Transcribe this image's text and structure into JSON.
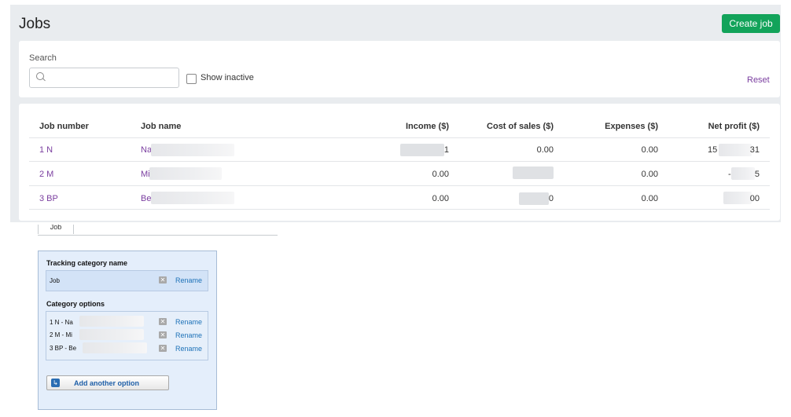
{
  "header": {
    "title": "Jobs",
    "create_label": "Create job"
  },
  "filters": {
    "search_label": "Search",
    "search_value": "",
    "show_inactive_label": "Show inactive",
    "show_inactive_checked": false,
    "reset_label": "Reset"
  },
  "table": {
    "columns": [
      "Job number",
      "Job name",
      "Income ($)",
      "Cost of sales ($)",
      "Expenses ($)",
      "Net profit ($)"
    ],
    "rows": [
      {
        "number": "1 N",
        "name": "Na",
        "income": "1",
        "cost": "0.00",
        "expenses": "0.00",
        "net": "15",
        "net_tail": "31"
      },
      {
        "number": "2 M",
        "name": "Mi",
        "income": "0.00",
        "cost": "",
        "expenses": "0.00",
        "net": "-",
        "net_tail": "5"
      },
      {
        "number": "3 BP",
        "name": "Be",
        "income": "0.00",
        "cost": "0",
        "expenses": "0.00",
        "net": "",
        "net_tail": "00"
      }
    ]
  },
  "legacy": {
    "tab_label": "Job",
    "tracking_heading": "Tracking category name",
    "tracking_name": "Job",
    "rename_label": "Rename",
    "options_heading": "Category options",
    "options": [
      "1 N - Na",
      "2 M - Mi",
      "3 BP - Be"
    ],
    "add_label": "Add another option"
  },
  "colors": {
    "accent": "#12a35a",
    "link": "#7b3fa0",
    "legacy_link": "#1e72b8"
  },
  "icons": {
    "search": "search-icon",
    "remove": "remove-x-icon",
    "add": "add-option-icon"
  }
}
